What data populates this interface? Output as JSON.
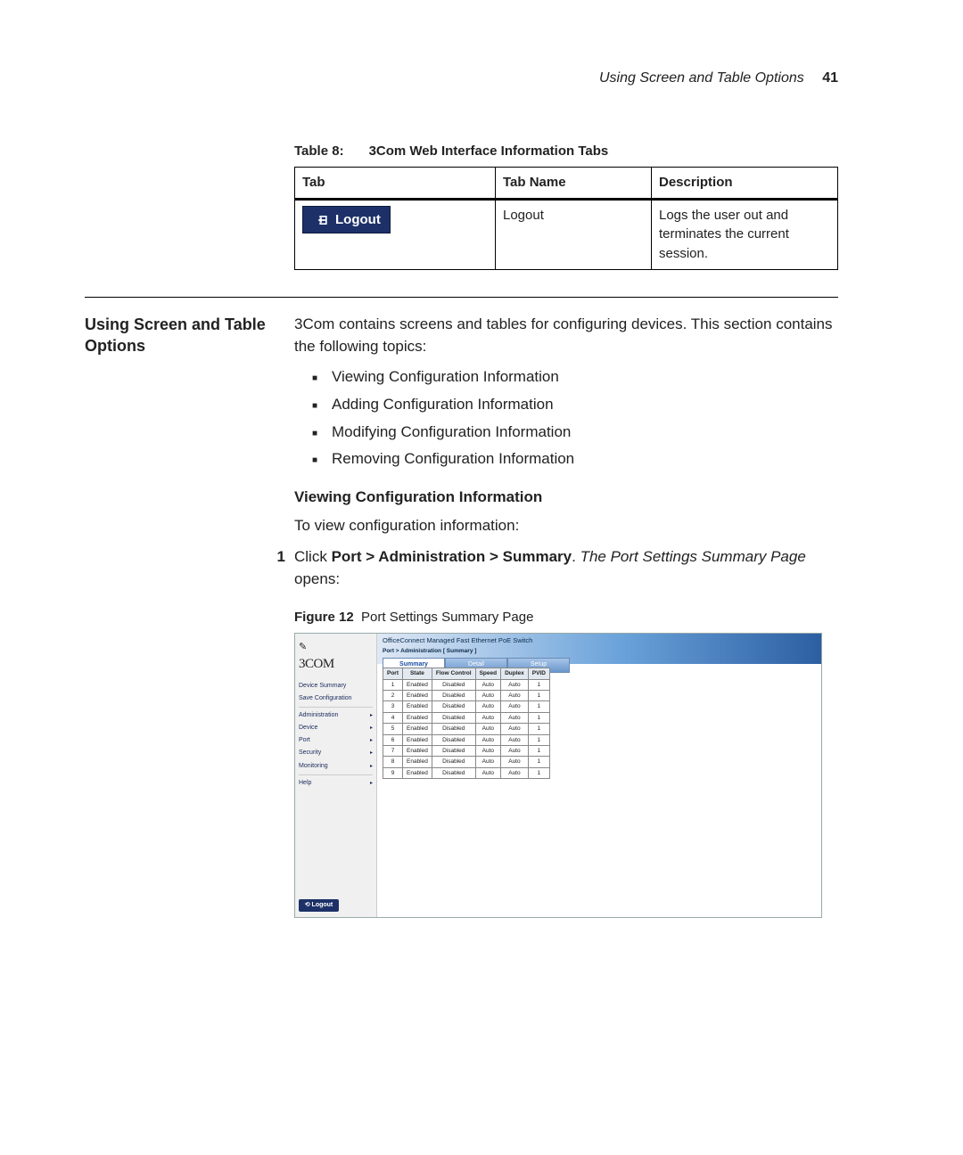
{
  "header": {
    "running": "Using Screen and Table Options",
    "page": "41"
  },
  "table8": {
    "caption_label": "Table 8:",
    "caption_title": "3Com Web Interface Information Tabs",
    "headers": {
      "tab": "Tab",
      "name": "Tab Name",
      "desc": "Description"
    },
    "row": {
      "pill_text": "Logout",
      "name": "Logout",
      "desc": "Logs the user out and terminates the current session."
    }
  },
  "section": {
    "heading": "Using Screen and Table Options",
    "intro": "3Com contains screens and tables for configuring devices. This section contains the following topics:",
    "bullets": [
      "Viewing Configuration Information",
      "Adding Configuration Information",
      "Modifying Configuration Information",
      "Removing Configuration Information"
    ],
    "sub_heading": "Viewing Configuration Information",
    "sub_intro": "To view configuration information:",
    "step_num": "1",
    "step_pre": "Click ",
    "step_bold": "Port > Administration > Summary",
    "step_post_dot": ". ",
    "step_em": "The Port Settings Summary Page",
    "step_tail": " opens:"
  },
  "figure": {
    "label": "Figure 12",
    "title": "Port Settings Summary Page"
  },
  "shot": {
    "logo": "3COM",
    "device_title": "OfficeConnect Managed Fast Ethernet PoE Switch",
    "breadcrumb": "Port > Administration [ Summary ]",
    "nav": {
      "top": [
        "Device Summary",
        "Save Configuration"
      ],
      "mid": [
        "Administration",
        "Device",
        "Port",
        "Security",
        "Monitoring"
      ],
      "help": "Help",
      "logout": "Logout"
    },
    "tabs": {
      "summary": "Summary",
      "detail": "Detail",
      "setup": "Setup"
    },
    "grid": {
      "headers": [
        "Port",
        "State",
        "Flow Control",
        "Speed",
        "Duplex",
        "PVID"
      ],
      "default": {
        "state": "Enabled",
        "flow": "Disabled",
        "speed": "Auto",
        "duplex": "Auto",
        "pvid": "1"
      }
    }
  },
  "chart_data": {
    "type": "table",
    "title": "Port Settings Summary",
    "columns": [
      "Port",
      "State",
      "Flow Control",
      "Speed",
      "Duplex",
      "PVID"
    ],
    "rows": [
      [
        1,
        "Enabled",
        "Disabled",
        "Auto",
        "Auto",
        1
      ],
      [
        2,
        "Enabled",
        "Disabled",
        "Auto",
        "Auto",
        1
      ],
      [
        3,
        "Enabled",
        "Disabled",
        "Auto",
        "Auto",
        1
      ],
      [
        4,
        "Enabled",
        "Disabled",
        "Auto",
        "Auto",
        1
      ],
      [
        5,
        "Enabled",
        "Disabled",
        "Auto",
        "Auto",
        1
      ],
      [
        6,
        "Enabled",
        "Disabled",
        "Auto",
        "Auto",
        1
      ],
      [
        7,
        "Enabled",
        "Disabled",
        "Auto",
        "Auto",
        1
      ],
      [
        8,
        "Enabled",
        "Disabled",
        "Auto",
        "Auto",
        1
      ],
      [
        9,
        "Enabled",
        "Disabled",
        "Auto",
        "Auto",
        1
      ]
    ]
  }
}
